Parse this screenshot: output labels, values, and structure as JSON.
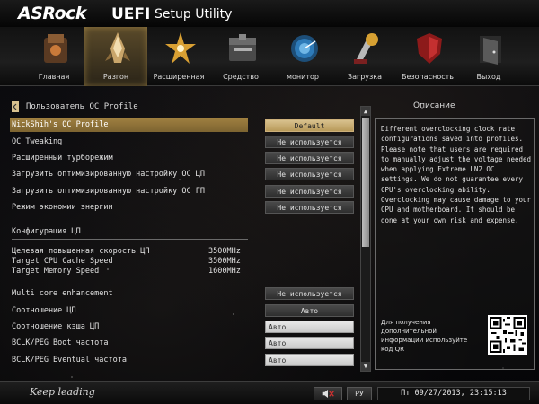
{
  "header": {
    "logo": "ASRock",
    "title_main": "UEFI",
    "title_sub": "Setup Utility"
  },
  "nav": {
    "tabs": [
      {
        "label": "Главная",
        "icon": "main-icon",
        "active": false
      },
      {
        "label": "Разгон",
        "icon": "oc-tweaker-icon",
        "active": true
      },
      {
        "label": "Расширенная",
        "icon": "advanced-icon",
        "active": false
      },
      {
        "label": "Средство",
        "icon": "tool-icon",
        "active": false
      },
      {
        "label": "монитор",
        "icon": "hardware-monitor-icon",
        "active": false
      },
      {
        "label": "Загрузка",
        "icon": "boot-icon",
        "active": false
      },
      {
        "label": "Безопасность",
        "icon": "security-icon",
        "active": false
      },
      {
        "label": "Выход",
        "icon": "exit-icon",
        "active": false
      }
    ]
  },
  "main": {
    "breadcrumb": "Пользователь OC Profile",
    "settings": [
      {
        "label": "NickShih's OC Profile",
        "value": "Default"
      },
      {
        "label": "OC Tweaking",
        "value": "Не используется"
      },
      {
        "label": "Расширенный турборежим",
        "value": "Не используется"
      },
      {
        "label": "Загрузить оптимизированную настройку ОС ЦП",
        "value": "Не используется"
      },
      {
        "label": "Загрузить оптимизированную настройку ОС ГП",
        "value": "Не используется"
      },
      {
        "label": "Режим экономии энергии",
        "value": "Не используется"
      }
    ],
    "cpu_section_title": "Конфигурация ЦП",
    "cpu_info": [
      {
        "label": "Целевая повышенная скорость ЦП",
        "value": "3500MHz"
      },
      {
        "label": "Target CPU Cache Speed",
        "value": "3500MHz"
      },
      {
        "label": "Target Memory Speed",
        "value": "1600MHz"
      }
    ],
    "cpu_settings": [
      {
        "label": "Multi core enhancement",
        "value": "Не используется"
      },
      {
        "label": "Соотношение ЦП",
        "value": "Авто"
      },
      {
        "label": "Соотношение кэша ЦП",
        "value": "Авто"
      },
      {
        "label": "BCLK/PEG Boot частота",
        "value": "Авто"
      },
      {
        "label": "BCLK/PEG Eventual частота",
        "value": "Авто"
      }
    ]
  },
  "description": {
    "title": "Описание",
    "text": "Different overclocking clock rate configurations saved into profiles. Please note that users are required to manually adjust the voltage needed when applying Extreme LN2 OC settings. We do not guarantee every CPU's overclocking ability. Overclocking may cause damage to your CPU and motherboard. It should be done at your own risk and expense.",
    "qr_text": "Для получения дополнительной информации используйте код QR"
  },
  "scrollbar": {
    "up_arrow": "▲",
    "down_arrow": "▼"
  },
  "footer": {
    "slogan": "Keep leading",
    "speaker_icon": "speaker-mute-icon",
    "language_label": "РУ",
    "datetime": "Пт 09/27/2013, 23:15:13"
  },
  "colors": {
    "accent_gold": "#a08040",
    "selected_option": "#d8c18e",
    "background": "#07070a"
  }
}
